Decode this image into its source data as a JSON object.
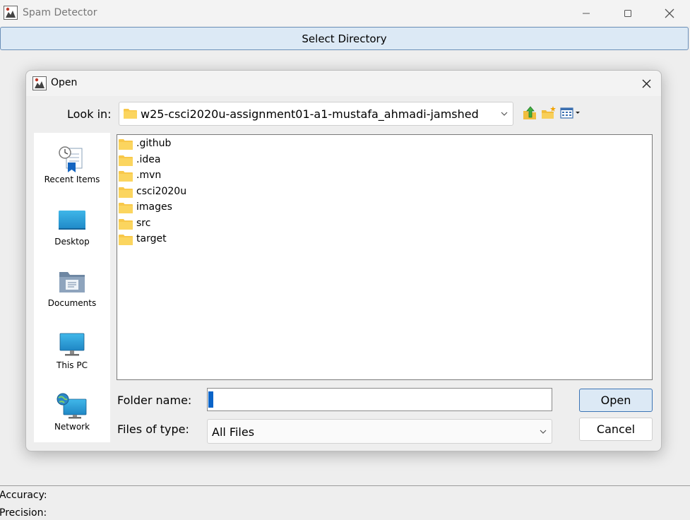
{
  "window": {
    "title": "Spam Detector",
    "icon": "java-app-icon",
    "controls": [
      "minimize-icon",
      "maximize-icon",
      "close-icon"
    ]
  },
  "toolbar": {
    "select_directory_label": "Select Directory"
  },
  "stats": {
    "accuracy_label": "Accuracy:",
    "precision_label": "Precision:"
  },
  "dialog": {
    "title": "Open",
    "look_in": {
      "label": "Look in:",
      "value": "w25-csci2020u-assignment01-a1-mustafa_ahmadi-jamshed"
    },
    "toolbar_icons": [
      "up-one-level-icon",
      "create-new-folder-icon",
      "view-menu-icon"
    ],
    "places": [
      {
        "id": "recent-items",
        "label": "Recent Items"
      },
      {
        "id": "desktop",
        "label": "Desktop"
      },
      {
        "id": "documents",
        "label": "Documents"
      },
      {
        "id": "this-pc",
        "label": "This PC"
      },
      {
        "id": "network",
        "label": "Network"
      }
    ],
    "files": [
      ".github",
      ".idea",
      ".mvn",
      "csci2020u",
      "images",
      "src",
      "target"
    ],
    "folder_name": {
      "label": "Folder name:",
      "value": "."
    },
    "files_of_type": {
      "label": "Files of type:",
      "value": "All Files"
    },
    "buttons": {
      "open": "Open",
      "cancel": "Cancel"
    }
  },
  "colors": {
    "accent_border": "#3c74b5",
    "button_fill": "#dce9f5",
    "folder_yellow": "#f8c84a",
    "selection_blue": "#0a64c8"
  }
}
